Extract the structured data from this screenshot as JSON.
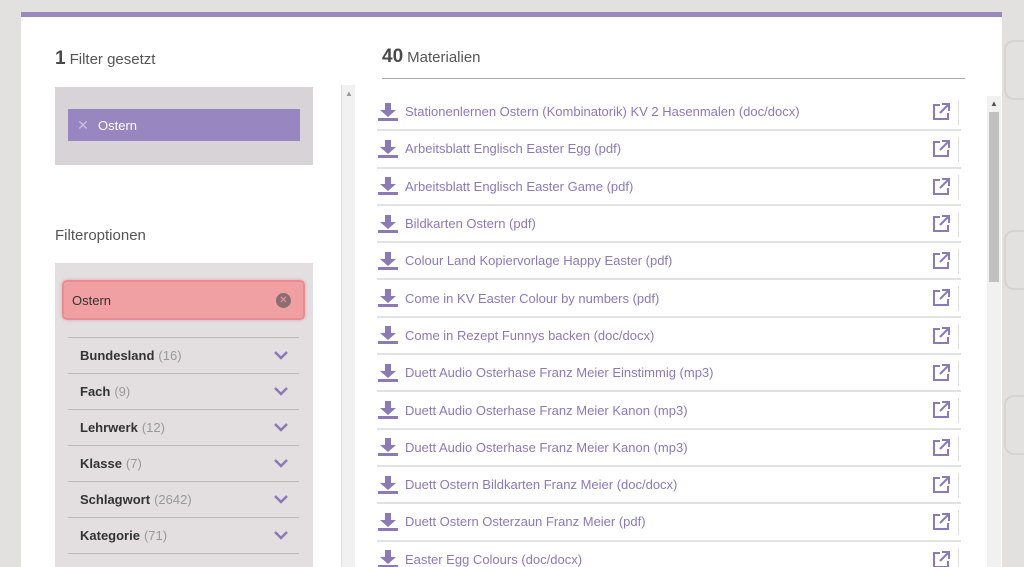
{
  "filters": {
    "active_count": "1",
    "active_label": "Filter gesetzt",
    "active_tags": [
      {
        "label": "Ostern",
        "remove_icon": "close-icon"
      }
    ]
  },
  "filteroptions": {
    "title": "Filteroptionen",
    "search_value": "Ostern",
    "facets": [
      {
        "name": "Bundesland",
        "count": "(16)"
      },
      {
        "name": "Fach",
        "count": "(9)"
      },
      {
        "name": "Lehrwerk",
        "count": "(12)"
      },
      {
        "name": "Klasse",
        "count": "(7)"
      },
      {
        "name": "Schlagwort",
        "count": "(2642)"
      },
      {
        "name": "Kategorie",
        "count": "(71)"
      }
    ]
  },
  "materials": {
    "count": "40",
    "label": "Materialien",
    "items": [
      {
        "title": "Stationenlernen Ostern (Kombinatorik) KV 2 Hasenmalen (doc/docx)"
      },
      {
        "title": "Arbeitsblatt Englisch Easter Egg (pdf)"
      },
      {
        "title": "Arbeitsblatt Englisch Easter Game (pdf)"
      },
      {
        "title": "Bildkarten Ostern (pdf)"
      },
      {
        "title": "Colour Land Kopiervorlage Happy Easter (pdf)"
      },
      {
        "title": "Come in KV Easter Colour by numbers (pdf)"
      },
      {
        "title": "Come in Rezept Funnys backen (doc/docx)"
      },
      {
        "title": "Duett Audio Osterhase Franz Meier Einstimmig (mp3)"
      },
      {
        "title": "Duett Audio Osterhase Franz Meier Kanon (mp3)"
      },
      {
        "title": "Duett Audio Osterhase Franz Meier Kanon (mp3)"
      },
      {
        "title": "Duett Ostern Bildkarten Franz Meier (doc/docx)"
      },
      {
        "title": "Duett Ostern Osterzaun Franz Meier (pdf)"
      },
      {
        "title": "Easter Egg Colours (doc/docx)"
      }
    ]
  },
  "colors": {
    "accent": "#9786c0",
    "link": "#8b79b8",
    "search_highlight": "#f0a0a3"
  }
}
